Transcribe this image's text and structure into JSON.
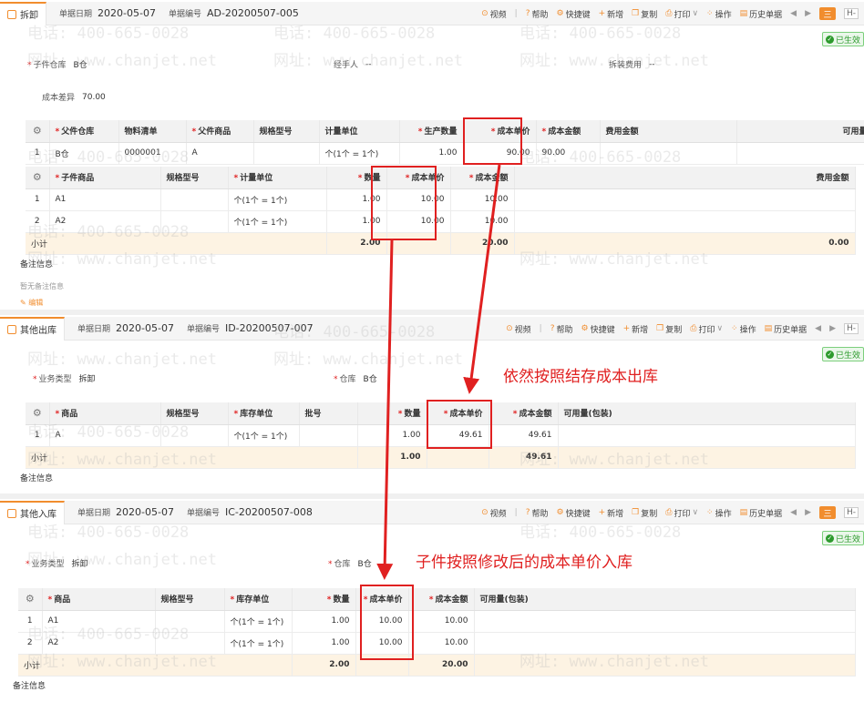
{
  "watermarks": {
    "phone": "电话: 400-665-0028",
    "site": "网址: www.chanjet.net"
  },
  "toolbar": {
    "video": "视频",
    "help": "帮助",
    "shortcut": "快捷键",
    "new": "新增",
    "copy": "复制",
    "print": "打印",
    "operate": "操作",
    "history": "历史单据",
    "menu_icon": "三",
    "side_tag": "H-"
  },
  "status": {
    "approved": "已生效"
  },
  "disassembly": {
    "tab": "拆卸",
    "date_label": "单据日期",
    "date": "2020-05-07",
    "no_label": "单据编号",
    "no": "AD-20200507-005",
    "child_wh_label": "子件仓库",
    "child_wh": "B仓",
    "handler_label": "经手人",
    "handler": "--",
    "fee_label": "拆装费用",
    "fee": "--",
    "cost_diff_label": "成本差异",
    "cost_diff": "70.00",
    "parent_table": {
      "headers": [
        "父件仓库",
        "物料清单",
        "父件商品",
        "规格型号",
        "计量单位",
        "生产数量",
        "成本单价",
        "成本金额",
        "费用金额",
        "可用量"
      ],
      "rows": [
        [
          "1",
          "B仓",
          "0000001",
          "A",
          "",
          "个(1个 = 1个)",
          "1.00",
          "90.00",
          "90.00",
          "",
          ""
        ]
      ]
    },
    "child_table": {
      "headers": [
        "子件商品",
        "规格型号",
        "计量单位",
        "数量",
        "成本单价",
        "成本金额",
        "费用金额"
      ],
      "rows": [
        [
          "1",
          "A1",
          "",
          "个(1个 = 1个)",
          "1.00",
          "10.00",
          "10.00",
          ""
        ],
        [
          "2",
          "A2",
          "",
          "个(1个 = 1个)",
          "1.00",
          "10.00",
          "10.00",
          ""
        ]
      ],
      "subtotal_label": "小计",
      "subtotal_qty": "2.00",
      "subtotal_amount": "20.00",
      "subtotal_fee": "0.00"
    },
    "remarks_title": "备注信息",
    "remarks_empty": "暂无备注信息",
    "edit": "编辑"
  },
  "outbound": {
    "tab": "其他出库",
    "date_label": "单据日期",
    "date": "2020-05-07",
    "no_label": "单据编号",
    "no": "ID-20200507-007",
    "biz_type_label": "业务类型",
    "biz_type": "拆卸",
    "warehouse_label": "仓库",
    "warehouse": "B仓",
    "table": {
      "headers": [
        "商品",
        "规格型号",
        "库存单位",
        "批号",
        "数量",
        "成本单价",
        "成本金额",
        "可用量(包装)"
      ],
      "rows": [
        [
          "1",
          "A",
          "",
          "个(1个 = 1个)",
          "",
          "1.00",
          "49.61",
          "49.61",
          ""
        ]
      ],
      "subtotal_label": "小计",
      "subtotal_qty": "1.00",
      "subtotal_amount": "49.61"
    },
    "remarks_title": "备注信息"
  },
  "inbound": {
    "tab": "其他入库",
    "date_label": "单据日期",
    "date": "2020-05-07",
    "no_label": "单据编号",
    "no": "IC-20200507-008",
    "biz_type_label": "业务类型",
    "biz_type": "拆卸",
    "warehouse_label": "仓库",
    "warehouse": "B仓",
    "table": {
      "headers": [
        "商品",
        "规格型号",
        "库存单位",
        "数量",
        "成本单价",
        "成本金额",
        "可用量(包装)"
      ],
      "rows": [
        [
          "1",
          "A1",
          "",
          "个(1个 = 1个)",
          "1.00",
          "10.00",
          "10.00",
          ""
        ],
        [
          "2",
          "A2",
          "",
          "个(1个 = 1个)",
          "1.00",
          "10.00",
          "10.00",
          ""
        ]
      ],
      "subtotal_label": "小计",
      "subtotal_qty": "2.00",
      "subtotal_amount": "20.00"
    },
    "remarks_title": "备注信息"
  },
  "annotations": {
    "outbound_note": "依然按照结存成本出库",
    "inbound_note": "子件按照修改后的成本单价入库"
  }
}
